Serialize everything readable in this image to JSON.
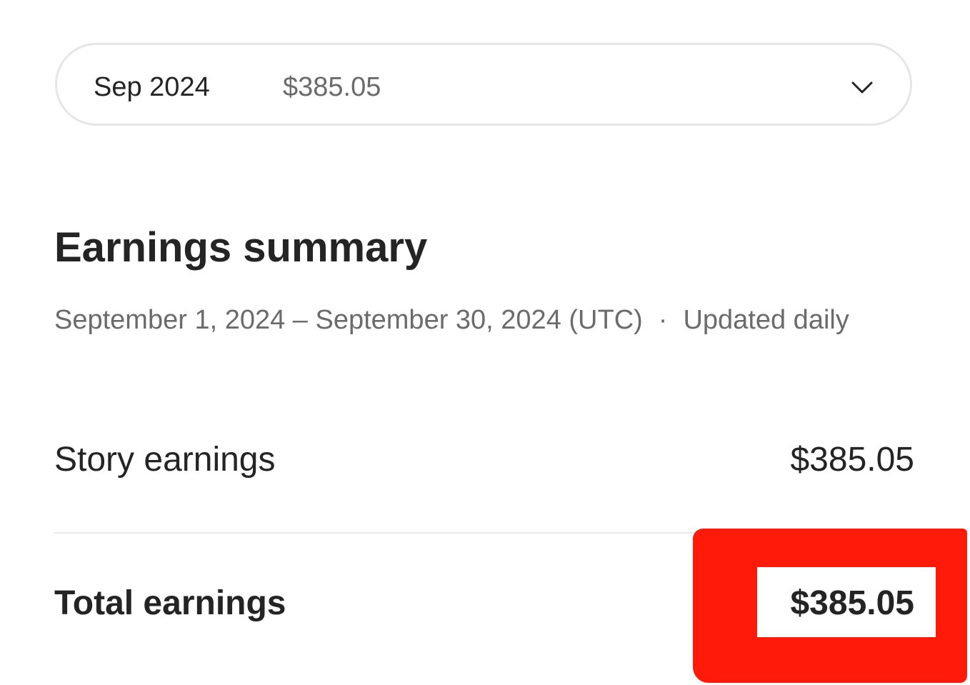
{
  "month_selector": {
    "month": "Sep 2024",
    "amount": "$385.05",
    "icon": "chevron-down-icon"
  },
  "summary": {
    "title": "Earnings summary",
    "date_range": "September 1, 2024 – September 30, 2024 (UTC)",
    "separator": "·",
    "update_note": "Updated daily"
  },
  "rows": {
    "story": {
      "label": "Story earnings",
      "value": "$385.05"
    },
    "total": {
      "label": "Total earnings",
      "value": "$385.05"
    }
  },
  "colors": {
    "text_primary": "#242424",
    "text_secondary": "#6b6b6b",
    "border": "#e6e6e6",
    "highlight": "#ff1a0a"
  }
}
